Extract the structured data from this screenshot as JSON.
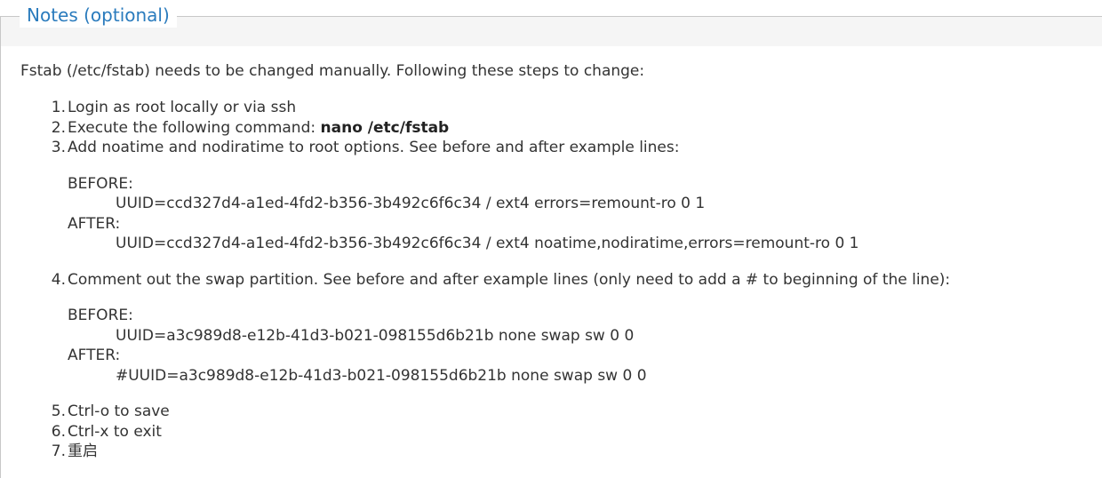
{
  "notes": {
    "title": "Notes (optional)",
    "intro": "Fstab (/etc/fstab) needs to be changed manually. Following these steps to change:",
    "steps": [
      {
        "num": "1.",
        "text": "Login as root locally or via ssh"
      },
      {
        "num": "2.",
        "text": "Execute the following command: ",
        "command": "nano /etc/fstab"
      },
      {
        "num": "3.",
        "text": "Add noatime and nodiratime to root options. See before and after example lines:"
      },
      {
        "num": "4.",
        "text": "Comment out the swap partition. See before and after example lines (only need to add a # to beginning of the line):"
      },
      {
        "num": "5.",
        "text": "Ctrl-o to save"
      },
      {
        "num": "6.",
        "text": "Ctrl-x to exit"
      },
      {
        "num": "7.",
        "text": "重启"
      }
    ],
    "example_root": {
      "before_label": "BEFORE:",
      "before_line": "UUID=ccd327d4-a1ed-4fd2-b356-3b492c6f6c34 / ext4 errors=remount-ro 0 1",
      "after_label": "AFTER:",
      "after_line": "UUID=ccd327d4-a1ed-4fd2-b356-3b492c6f6c34 / ext4 noatime,nodiratime,errors=remount-ro 0 1"
    },
    "example_swap": {
      "before_label": "BEFORE:",
      "before_line": "UUID=a3c989d8-e12b-41d3-b021-098155d6b21b none swap sw 0 0",
      "after_label": "AFTER:",
      "after_line": "#UUID=a3c989d8-e12b-41d3-b021-098155d6b21b none swap sw 0 0"
    }
  },
  "colors": {
    "legend": "#2a7bbd",
    "text": "#333333",
    "border": "#c8c8c8",
    "band": "#f5f5f5"
  }
}
